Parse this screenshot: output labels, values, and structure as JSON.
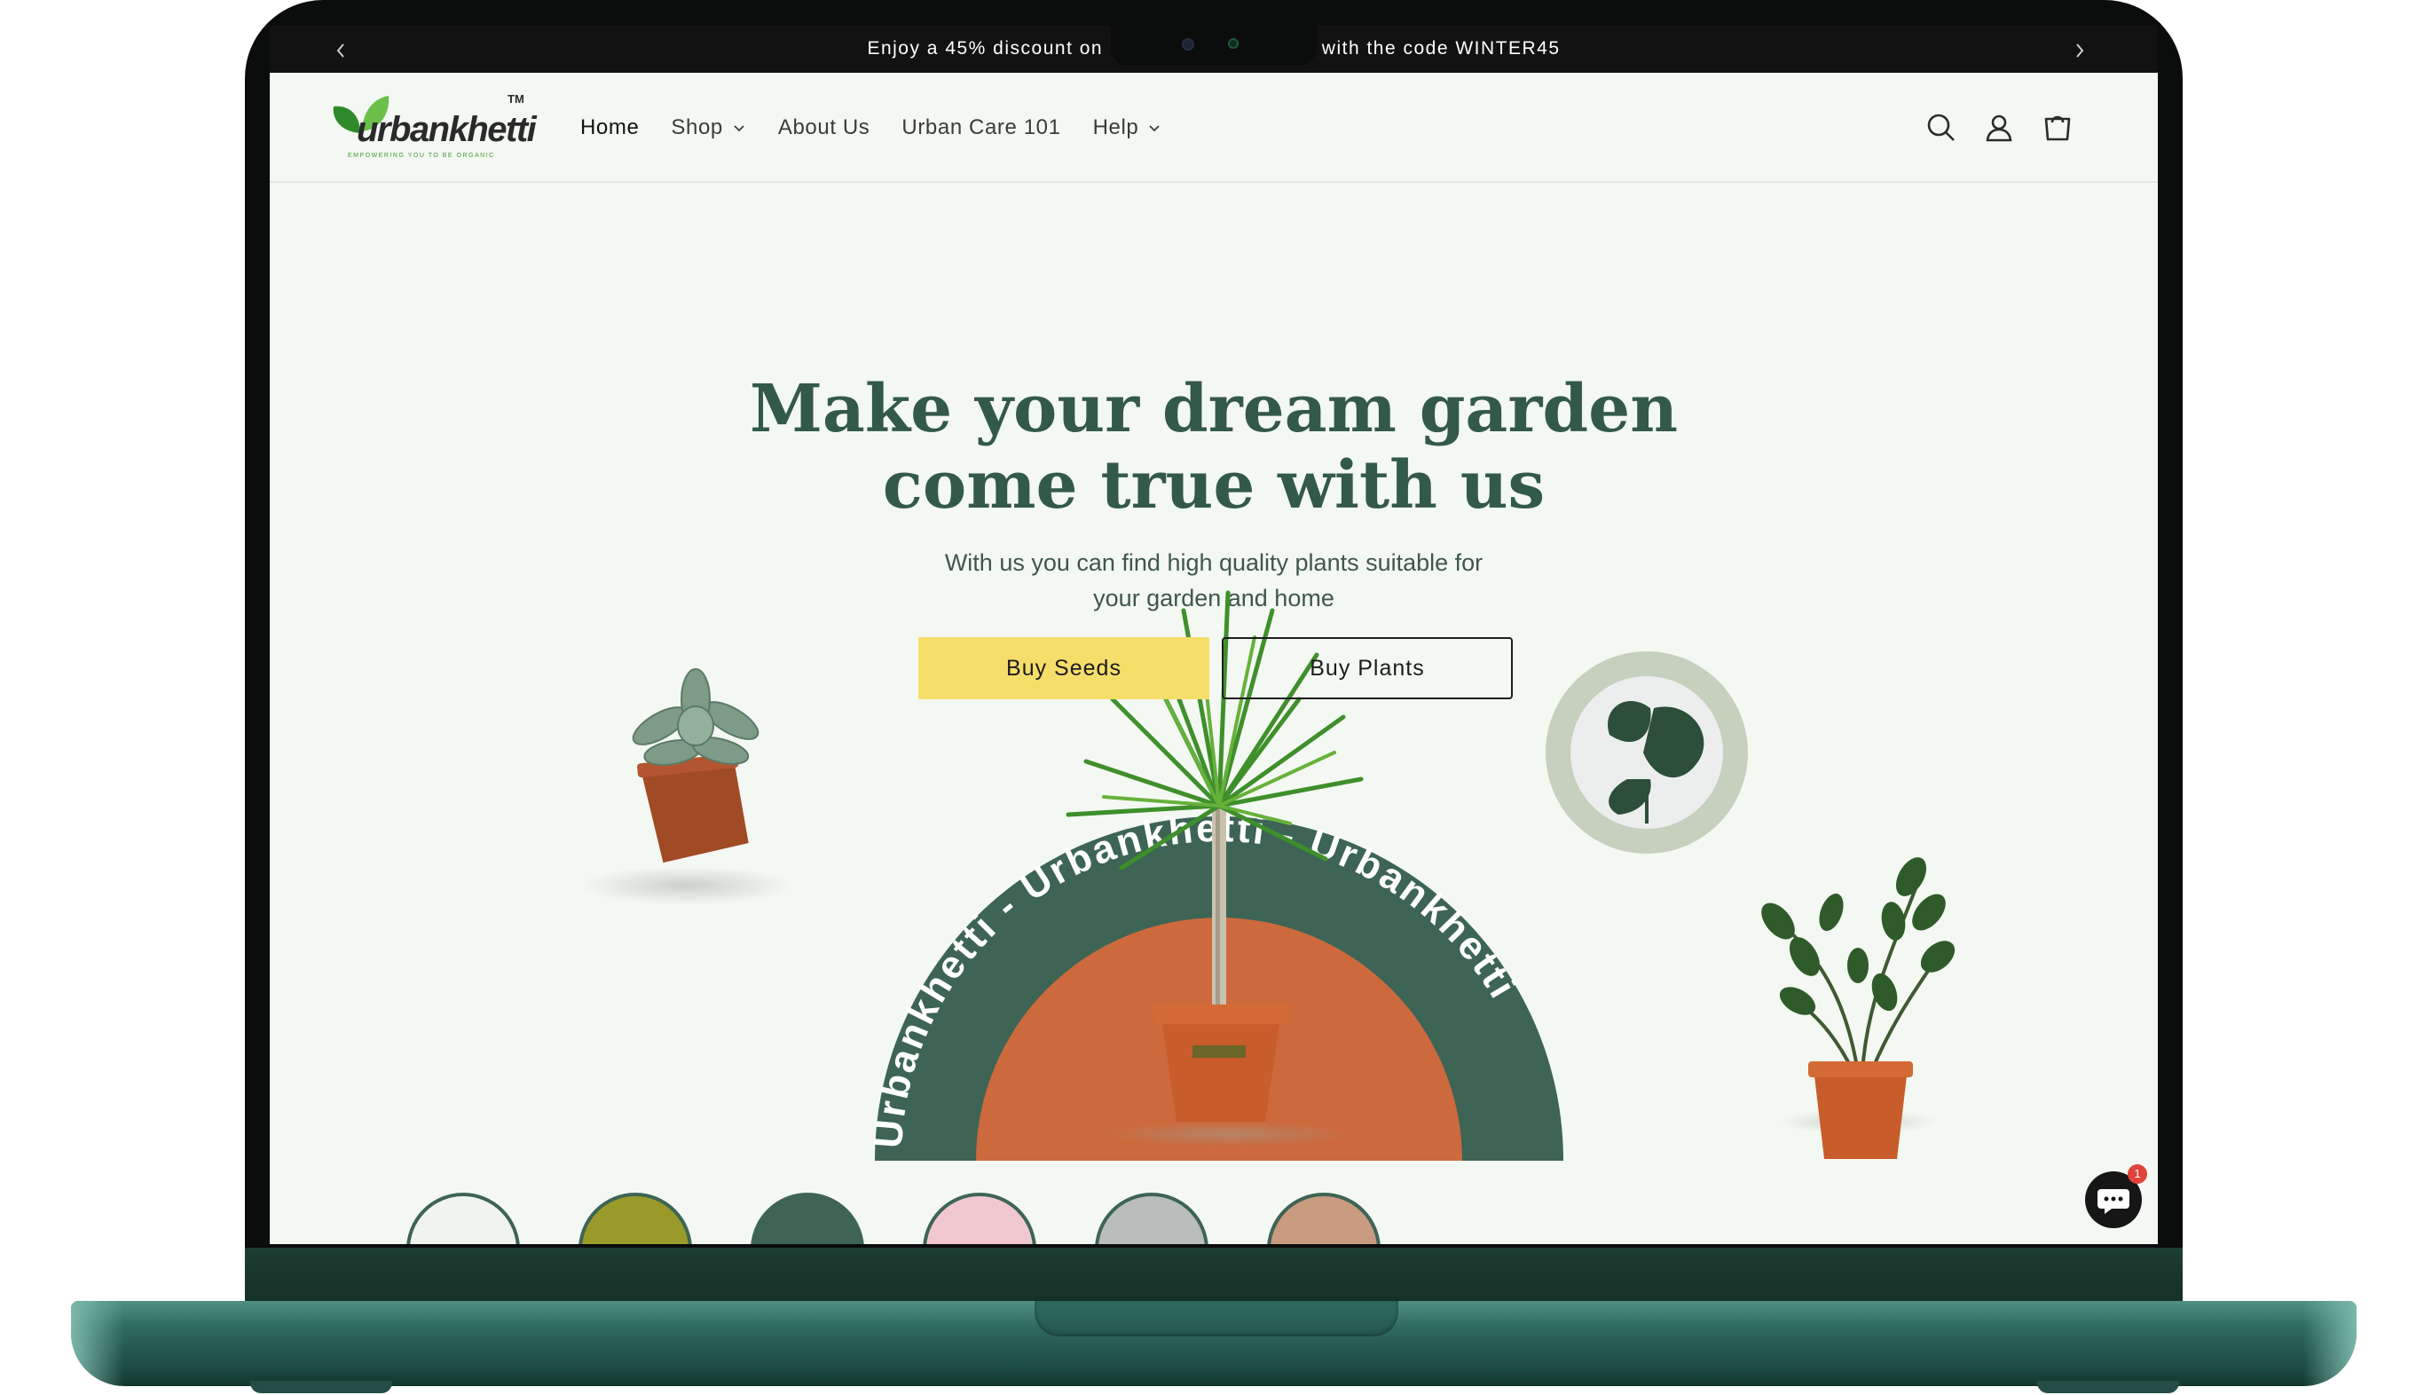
{
  "announcement": {
    "text_left": "Enjoy a 45% discount on",
    "text_right": "with the code WINTER45",
    "prev_icon": "chevron-left-icon",
    "next_icon": "chevron-right-icon"
  },
  "brand": {
    "name": "urbankhetti",
    "tm": "TM",
    "tagline": "EMPOWERING YOU TO BE ORGANIC",
    "color_green": "#3f9b36"
  },
  "nav": {
    "items": [
      {
        "label": "Home",
        "active": true,
        "dropdown": false
      },
      {
        "label": "Shop",
        "active": false,
        "dropdown": true
      },
      {
        "label": "About Us",
        "active": false,
        "dropdown": false
      },
      {
        "label": "Urban Care 101",
        "active": false,
        "dropdown": false
      },
      {
        "label": "Help",
        "active": false,
        "dropdown": true
      }
    ]
  },
  "header_icons": [
    "search-icon",
    "account-icon",
    "cart-icon"
  ],
  "hero": {
    "title_line1": "Make your dream garden",
    "title_line2": "come true with us",
    "subtitle_line1": "With us you can find high quality plants suitable for",
    "subtitle_line2": "your garden and home",
    "buttons": {
      "seeds": "Buy Seeds",
      "plants": "Buy Plants"
    },
    "arch_text": "Urbankhetti - Urbankhetti - Urbankhetti",
    "colors": {
      "title": "#33594a",
      "arch": "#3d6455",
      "terracotta": "#cc6a3e",
      "seeds_button": "#f6de6b",
      "badge_ring": "#c6d0bf"
    }
  },
  "chat": {
    "icon": "chat-icon",
    "badge": "1"
  }
}
